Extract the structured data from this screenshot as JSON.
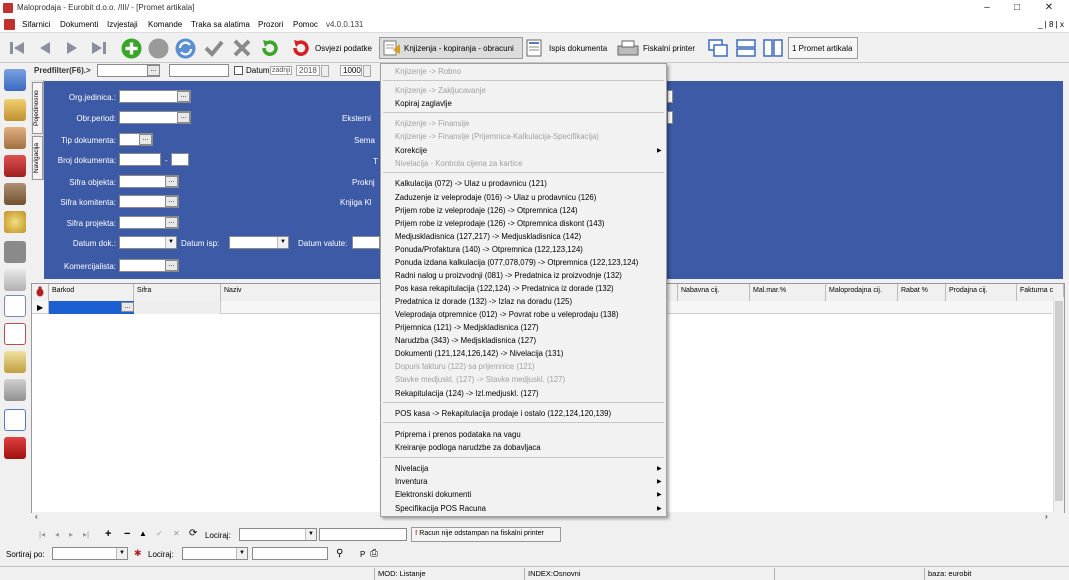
{
  "window": {
    "title": "Maloprodaja - Eurobit d.o.o. /III/ - [Promet artikala]",
    "minimize": "–",
    "maximize": "□",
    "close": "✕",
    "child_controls": "_ | 8 | x"
  },
  "menubar": {
    "items": [
      "Sifarnici",
      "Dokumenti",
      "Izvjestaji",
      "Komande",
      "Traka sa alatima",
      "Prozori",
      "Pomoc",
      "v4.0.0.131"
    ]
  },
  "toolbar": {
    "refresh_label": "Osvjezi podatke",
    "posting_label": "Knjizenja - kopiranja - obracuni",
    "print_label": "Ispis dokumenta",
    "fiscal_label": "Fiskalni printer",
    "window_tab_label": "1 Promet artikala"
  },
  "filter": {
    "predfilter_label": "Predfilter(F6).>",
    "datum_label": "Datum",
    "zadnji_label": "zadnji",
    "year_value": "2018",
    "count_value": "1000"
  },
  "form": {
    "org_label": "Org.jedinica.:",
    "obr_label": "Obr.period:",
    "tip_label": "Tip dokumenta:",
    "broj_label": "Broj dokumenta:",
    "broj_sep": "-",
    "sifra_objekta_label": "Sifra objekta:",
    "sifra_komitenta_label": "Sifra komitenta:",
    "sifra_projekta_label": "Sifra projekta:",
    "datum_dok_label": "Datum dok.:",
    "datum_isp_label": "Datum isp:",
    "datum_valute_label": "Datum valute:",
    "komercijalista_label": "Komercijalista:",
    "eksterni_label": "Eksterni",
    "sema_label": "Sema",
    "t_label": "T",
    "proknj_label": "Proknj",
    "knjiga_label": "Knjiga Kl"
  },
  "vtabs": [
    "Pojedinosno",
    "Navigacija"
  ],
  "grid": {
    "headers": [
      "Barkod",
      "Sifra",
      "Naziv",
      "Nabavna cij.",
      "Mal.mar.%",
      "Maloprodajna cij.",
      "Rabat %",
      "Prodajna cij.",
      "Fakturna c"
    ]
  },
  "menu": {
    "items": [
      {
        "label": "Knjizenje -> Robno",
        "disabled": true
      },
      {
        "label": "Knjizenje -> Zakljucavanje",
        "disabled": true
      },
      {
        "label": "Kopiraj zaglavlje",
        "disabled": false
      },
      {
        "label": "Knjizenje -> Finansije",
        "disabled": true
      },
      {
        "label": "Knjizenje -> Finansije (Prijemnica-Kalkulacija-Specifikacija)",
        "disabled": true
      },
      {
        "label": "Korekcije",
        "disabled": false,
        "submenu": true
      },
      {
        "label": "Nivelacija - Kontrola cijena za kartice",
        "disabled": true
      },
      {
        "label": "Kalkulacija (072) -> Ulaz u prodavnicu (121)",
        "disabled": false
      },
      {
        "label": "Zaduzenje iz veleprodaje (016) -> Ulaz u prodavnicu (126)",
        "disabled": false
      },
      {
        "label": "Prijem robe iz veleprodaje (126) -> Otpremnica (124)",
        "disabled": false
      },
      {
        "label": "Prijem robe iz veleprodaje (126) -> Otpremnica diskont (143)",
        "disabled": false
      },
      {
        "label": "Medjuskladisnica (127,217) -> Medjuskladisnica (142)",
        "disabled": false
      },
      {
        "label": "Ponuda/Profaktura (140) -> Otpremnica (122,123,124)",
        "disabled": false
      },
      {
        "label": "Ponuda izdana kalkulacija (077,078,079) -> Otpremnica (122,123,124)",
        "disabled": false
      },
      {
        "label": "Radni nalog u proizvodnji (081) -> Predatnica iz proizvodnje (132)",
        "disabled": false
      },
      {
        "label": "Pos kasa rekapitulacija (122,124) -> Predatnica iz dorade (132)",
        "disabled": false
      },
      {
        "label": "Predatnica iz dorade (132) -> Izlaz na doradu (125)",
        "disabled": false
      },
      {
        "label": "Veleprodaja otpremnice (012) -> Povrat robe u veleprodaju (138)",
        "disabled": false
      },
      {
        "label": "Prijemnica (121) -> Medjskladisnica (127)",
        "disabled": false
      },
      {
        "label": "Narudzba (343) -> Medjskladisnica (127)",
        "disabled": false
      },
      {
        "label": "Dokumenti (121,124,126,142) -> Nivelacija (131)",
        "disabled": false
      },
      {
        "label": "Dopuni fakturu (122) sa prijemnice (121)",
        "disabled": true
      },
      {
        "label": "Stavke medjuskl. (127) -> Stavke medjuskl. (127)",
        "disabled": true
      },
      {
        "label": "Rekapitulacija (124) -> Izl.medjuskl. (127)",
        "disabled": false
      },
      {
        "label": "POS kasa -> Rekapitulacija prodaje i ostalo (122,124,120,139)",
        "disabled": false
      },
      {
        "label": "Priprema i prenos podataka na vagu",
        "disabled": false
      },
      {
        "label": "Kreiranje podloga narudzbe za dobavljaca",
        "disabled": false
      },
      {
        "label": "Nivelacija",
        "disabled": false,
        "submenu": true
      },
      {
        "label": "Inventura",
        "disabled": false,
        "submenu": true
      },
      {
        "label": "Elektronski dokumenti",
        "disabled": false,
        "submenu": true
      },
      {
        "label": "Specifikacija POS Racuna",
        "disabled": false,
        "submenu": true
      }
    ]
  },
  "navbar": {
    "locate_label": "Lociraj:",
    "fiscal_note": "Racun nije odstampan na fiskalni printer"
  },
  "sortbar": {
    "sort_label": "Sortiraj po:",
    "locate_label": "Lociraj:",
    "p_label": "P"
  },
  "status": {
    "mode": "MOD: Listanje",
    "index": "INDEX:Osnovni",
    "db": "baza: eurobit"
  },
  "colors": {
    "panel_blue": "#3c5aa6",
    "grid_selected": "#1c5fd0",
    "brand_red": "#c0302c"
  }
}
